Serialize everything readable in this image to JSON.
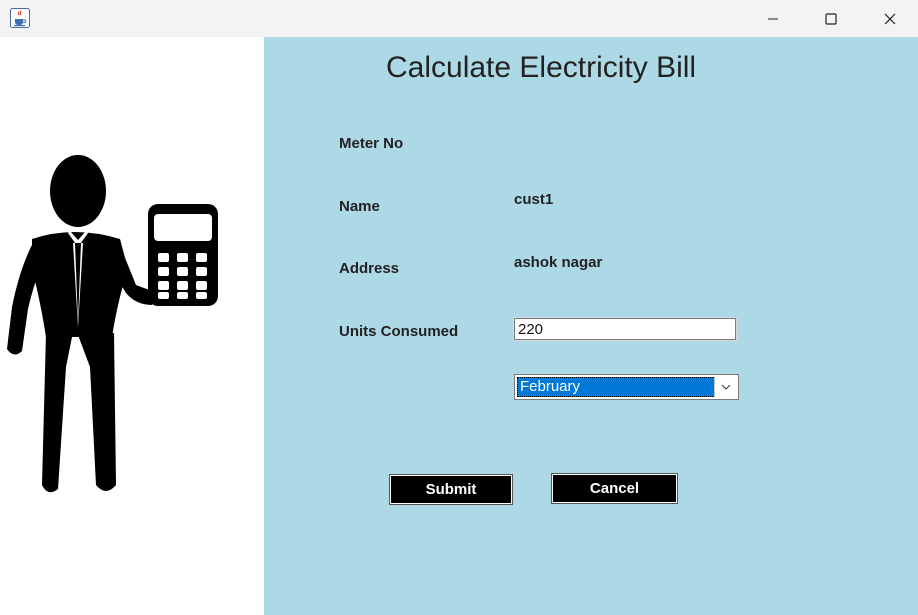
{
  "window": {
    "app_icon": "java-coffee-cup-icon",
    "controls": [
      "minimize-icon",
      "maximize-icon",
      "close-icon"
    ]
  },
  "illustration": {
    "icon": "man-with-calculator-icon"
  },
  "form": {
    "title": "Calculate Electricity Bill",
    "meter_no_label": "Meter No",
    "meter_no_value": "",
    "name_label": "Name",
    "name_value": "cust1",
    "address_label": "Address",
    "address_value": "ashok nagar",
    "units_label": "Units Consumed",
    "units_value": "220",
    "month_selected": "February",
    "submit_label": "Submit",
    "cancel_label": "Cancel"
  },
  "colors": {
    "panel_bg": "#add8e6",
    "button_bg": "#000000",
    "selection": "#0078d7"
  }
}
